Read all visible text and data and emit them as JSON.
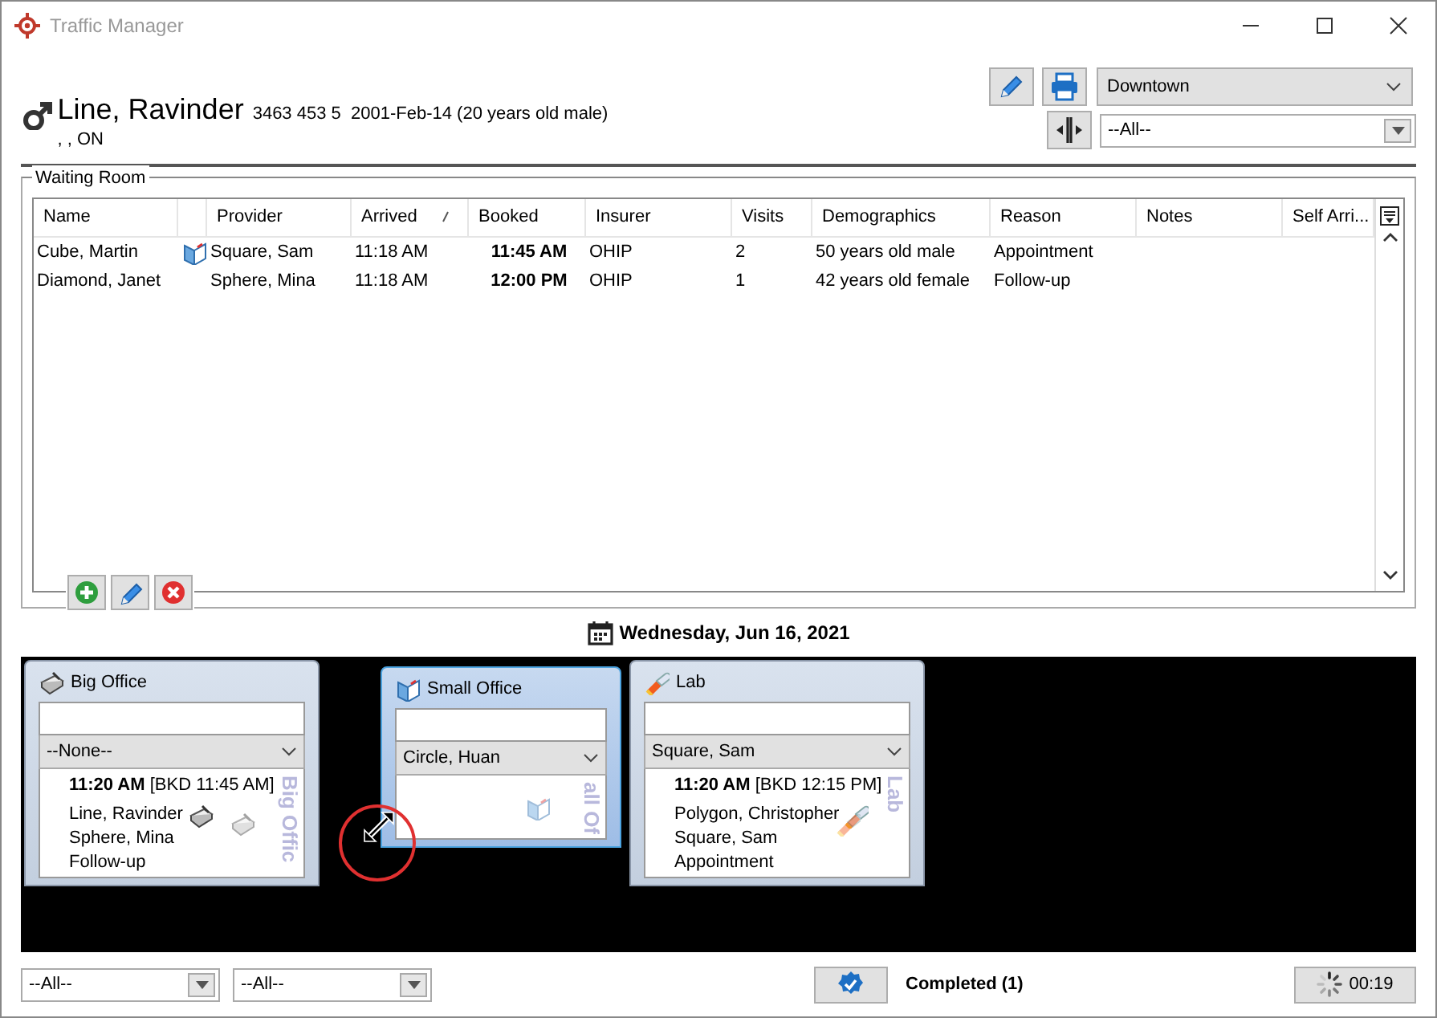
{
  "window": {
    "title": "Traffic Manager"
  },
  "patient": {
    "name": "Line, Ravinder",
    "details": "3463 453 5  2001-Feb-14 (20 years old male)",
    "address": ", , ON"
  },
  "location_select": {
    "value": "Downtown"
  },
  "filter_select": {
    "value": "--All--"
  },
  "waiting_room": {
    "title": "Waiting Room",
    "columns": [
      {
        "kind": "text",
        "label": "Name",
        "sorted": false
      },
      {
        "kind": "icon"
      },
      {
        "kind": "text",
        "label": "Provider",
        "sorted": false
      },
      {
        "kind": "text",
        "label": "Arrived",
        "sorted": true
      },
      {
        "kind": "text",
        "label": "Booked",
        "sorted": false
      },
      {
        "kind": "text",
        "label": "Insurer",
        "sorted": false
      },
      {
        "kind": "text",
        "label": "Visits",
        "sorted": false
      },
      {
        "kind": "text",
        "label": "Demographics",
        "sorted": false
      },
      {
        "kind": "text",
        "label": "Reason",
        "sorted": false
      },
      {
        "kind": "text",
        "label": "Notes",
        "sorted": false
      },
      {
        "kind": "text",
        "label": "Self Arri..."
      }
    ],
    "rows": [
      {
        "name": "Cube, Martin",
        "has_icon": true,
        "provider": "Square, Sam",
        "arrived": "11:18 AM",
        "booked": "11:45 AM",
        "insurer": "OHIP",
        "visits": "2",
        "demographics": "50 years old male",
        "reason": "Appointment"
      },
      {
        "name": "Diamond, Janet",
        "has_icon": false,
        "provider": "Sphere, Mina",
        "arrived": "11:18 AM",
        "booked": "12:00 PM",
        "insurer": "OHIP",
        "visits": "1",
        "demographics": "42 years old female",
        "reason": "Follow-up"
      }
    ]
  },
  "date": "Wednesday, Jun 16, 2021",
  "rooms": [
    {
      "title": "Big Office",
      "kind": "office",
      "selected": false,
      "provider": "--None--",
      "watermark": "Big Offic",
      "appointment": {
        "time": "**11:20 AM** [BKD 11:45 AM]",
        "patient": "Line, Ravinder",
        "provider": "Sphere, Mina",
        "reason": "Follow-up"
      }
    },
    {
      "title": "Small Office",
      "kind": "exam",
      "selected": true,
      "provider": "Circle, Huan",
      "watermark": "all Of"
    },
    {
      "title": "Lab",
      "kind": "lab",
      "selected": false,
      "provider": "Square, Sam",
      "watermark": "Lab",
      "appointment": {
        "time": "**11:20 AM** [BKD 12:15 PM]",
        "patient": "Polygon, Christopher",
        "provider": "Square, Sam",
        "reason": "Appointment"
      }
    }
  ],
  "bottom_filters": [
    {
      "value": "--All--"
    },
    {
      "value": "--All--"
    }
  ],
  "completed": {
    "label": "Completed (1)"
  },
  "timer": {
    "label": "00:19"
  }
}
